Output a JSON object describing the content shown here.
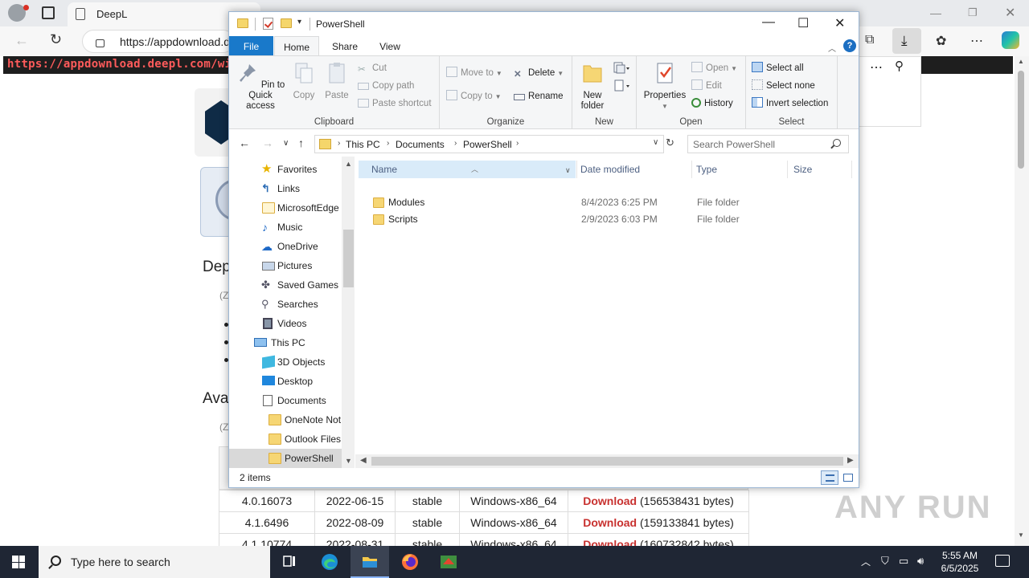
{
  "browser": {
    "tab_title": "DeepL",
    "url": "https://appdownload.d",
    "url_banner": "https://appdownload.deepl.com/window"
  },
  "page": {
    "heading1": "Dep",
    "sub1": "(Z",
    "heading2": "Ava",
    "sub2": "(Z",
    "rows": [
      {
        "version": "4.0.16073",
        "date": "2022-06-15",
        "channel": "stable",
        "platform": "Windows-x86_64",
        "link": "Download",
        "size": "(156538431 bytes)"
      },
      {
        "version": "4.1.6496",
        "date": "2022-08-09",
        "channel": "stable",
        "platform": "Windows-x86_64",
        "link": "Download",
        "size": "(159133841 bytes)"
      },
      {
        "version": "4.1.10774",
        "date": "2022-08-31",
        "channel": "stable",
        "platform": "Windows-x86_64",
        "link": "Download",
        "size": "(160732842 bytes)"
      }
    ],
    "watermark": "ANY RUN"
  },
  "explorer": {
    "title": "PowerShell",
    "ribbon_tabs": [
      "File",
      "Home",
      "Share",
      "View"
    ],
    "help": "?",
    "clipboard": {
      "pin": "Pin to Quick access",
      "copy": "Copy",
      "paste": "Paste",
      "cut": "Cut",
      "copy_path": "Copy path",
      "paste_shortcut": "Paste shortcut",
      "label": "Clipboard"
    },
    "organize": {
      "move_to": "Move to",
      "copy_to": "Copy to",
      "delete": "Delete",
      "rename": "Rename",
      "label": "Organize"
    },
    "new": {
      "new_folder": "New folder",
      "label": "New"
    },
    "open": {
      "properties": "Properties",
      "open": "Open",
      "edit": "Edit",
      "history": "History",
      "label": "Open"
    },
    "select": {
      "select_all": "Select all",
      "select_none": "Select none",
      "invert": "Invert selection",
      "label": "Select"
    },
    "breadcrumb": [
      "This PC",
      "Documents",
      "PowerShell"
    ],
    "search_placeholder": "Search PowerShell",
    "nav": [
      {
        "label": "Favorites",
        "icon": "star-icon"
      },
      {
        "label": "Links",
        "icon": "links-icon"
      },
      {
        "label": "MicrosoftEdge",
        "icon": "folder-icon"
      },
      {
        "label": "Music",
        "icon": "music-icon"
      },
      {
        "label": "OneDrive",
        "icon": "cloud-icon"
      },
      {
        "label": "Pictures",
        "icon": "pictures-icon"
      },
      {
        "label": "Saved Games",
        "icon": "games-icon"
      },
      {
        "label": "Searches",
        "icon": "search-icon"
      },
      {
        "label": "Videos",
        "icon": "videos-icon"
      },
      {
        "label": "This PC",
        "icon": "computer-icon"
      },
      {
        "label": "3D Objects",
        "icon": "cube-icon"
      },
      {
        "label": "Desktop",
        "icon": "desktop-icon"
      },
      {
        "label": "Documents",
        "icon": "documents-icon"
      },
      {
        "label": "OneNote Not",
        "icon": "folder-icon"
      },
      {
        "label": "Outlook Files",
        "icon": "folder-icon"
      },
      {
        "label": "PowerShell",
        "icon": "folder-icon"
      }
    ],
    "columns": [
      "Name",
      "Date modified",
      "Type",
      "Size"
    ],
    "files": [
      {
        "name": "Modules",
        "date": "8/4/2023 6:25 PM",
        "type": "File folder"
      },
      {
        "name": "Scripts",
        "date": "2/9/2023 6:03 PM",
        "type": "File folder"
      }
    ],
    "status": "2 items"
  },
  "taskbar": {
    "search_text": "Type here to search",
    "time": "5:55 AM",
    "date": "6/5/2025"
  }
}
